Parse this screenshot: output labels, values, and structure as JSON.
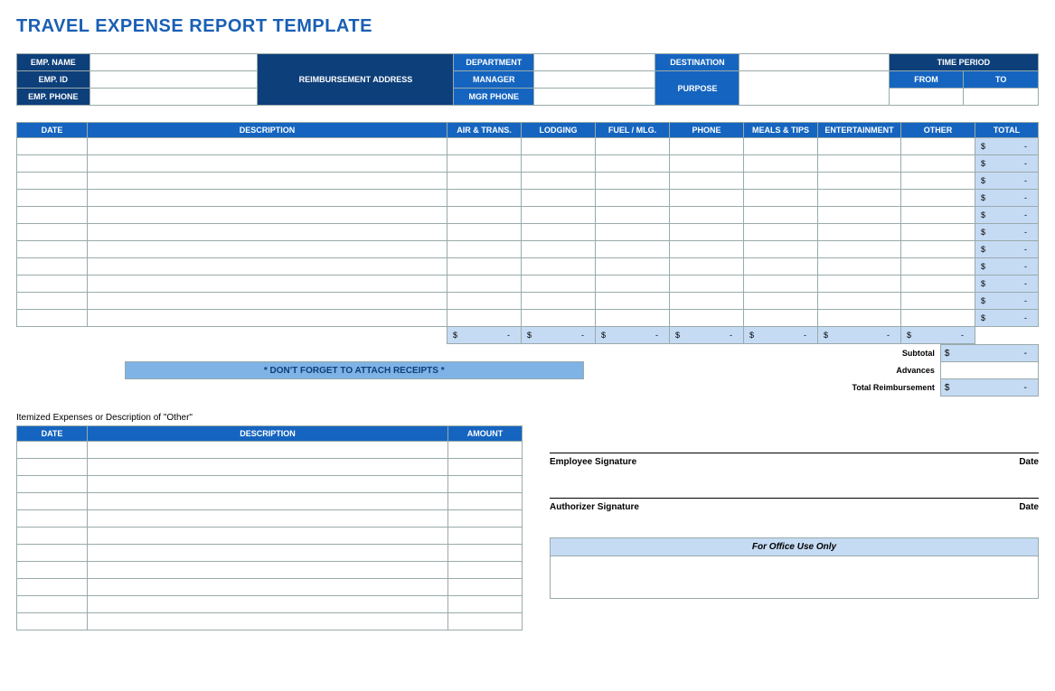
{
  "title": "TRAVEL EXPENSE REPORT TEMPLATE",
  "info": {
    "emp_name": "EMP. NAME",
    "emp_id": "EMP. ID",
    "emp_phone": "EMP. PHONE",
    "reimb_addr": "REIMBURSEMENT ADDRESS",
    "department": "DEPARTMENT",
    "manager": "MANAGER",
    "mgr_phone": "MGR PHONE",
    "destination": "DESTINATION",
    "purpose": "PURPOSE",
    "time_period": "TIME PERIOD",
    "from": "FROM",
    "to": "TO"
  },
  "main": {
    "cols": [
      "DATE",
      "DESCRIPTION",
      "AIR & TRANS.",
      "LODGING",
      "FUEL / MLG.",
      "PHONE",
      "MEALS & TIPS",
      "ENTERTAINMENT",
      "OTHER",
      "TOTAL"
    ],
    "rows": 11,
    "totcell": {
      "sym": "$",
      "dash": "-"
    },
    "colsum": {
      "sym": "$",
      "dash": "-"
    },
    "subtotal_lbl": "Subtotal",
    "advances_lbl": "Advances",
    "reimb_lbl": "Total Reimbursement",
    "reminder": "* DON'T FORGET TO ATTACH RECEIPTS *"
  },
  "itemized": {
    "caption": "Itemized Expenses or Description of \"Other\"",
    "cols": [
      "DATE",
      "DESCRIPTION",
      "AMOUNT"
    ],
    "rows": 11
  },
  "sign": {
    "emp": "Employee Signature",
    "auth": "Authorizer Signature",
    "date": "Date",
    "office": "For Office Use Only"
  }
}
